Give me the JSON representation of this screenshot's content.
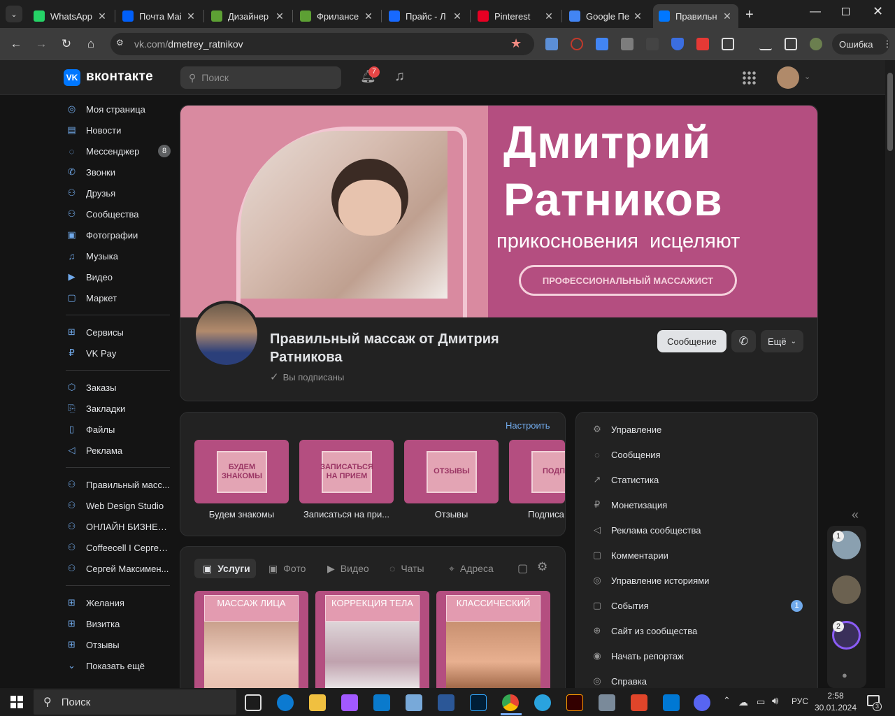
{
  "browser": {
    "tabs": [
      {
        "title": "WhatsApp",
        "icon": "whatsapp-icon",
        "color": "#25d366"
      },
      {
        "title": "Почта Mai",
        "icon": "mail-icon",
        "color": "#005ff9"
      },
      {
        "title": "Дизайнер",
        "icon": "fl-icon",
        "color": "#5da034"
      },
      {
        "title": "Фрилансе",
        "icon": "fl-icon",
        "color": "#5da034"
      },
      {
        "title": "Прайс - Л",
        "icon": "behance-icon",
        "color": "#1769ff"
      },
      {
        "title": "Pinterest",
        "icon": "pinterest-icon",
        "color": "#e60023"
      },
      {
        "title": "Google Пе",
        "icon": "translate-icon",
        "color": "#4285f4"
      },
      {
        "title": "Правильн",
        "icon": "vk-icon",
        "color": "#0077ff"
      }
    ],
    "url_host": "vk.com/",
    "url_path": "dmetrey_ratnikov",
    "profile_status": "Ошибка"
  },
  "vk": {
    "logo_text": "вконтакте",
    "search_placeholder": "Поиск",
    "notifications_count": "7",
    "sidebar": {
      "main": [
        {
          "label": "Моя страница",
          "icon": "user-circle-icon"
        },
        {
          "label": "Новости",
          "icon": "news-icon"
        },
        {
          "label": "Мессенджер",
          "icon": "message-icon",
          "badge": "8"
        },
        {
          "label": "Звонки",
          "icon": "phone-icon"
        },
        {
          "label": "Друзья",
          "icon": "friends-icon"
        },
        {
          "label": "Сообщества",
          "icon": "communities-icon"
        },
        {
          "label": "Фотографии",
          "icon": "photo-icon"
        },
        {
          "label": "Музыка",
          "icon": "music-icon"
        },
        {
          "label": "Видео",
          "icon": "video-icon"
        },
        {
          "label": "Маркет",
          "icon": "market-icon"
        }
      ],
      "services": [
        {
          "label": "Сервисы",
          "icon": "services-icon"
        },
        {
          "label": "VK Pay",
          "icon": "vkpay-icon"
        }
      ],
      "extra": [
        {
          "label": "Заказы",
          "icon": "box-icon"
        },
        {
          "label": "Закладки",
          "icon": "bookmark-icon"
        },
        {
          "label": "Файлы",
          "icon": "file-icon"
        },
        {
          "label": "Реклама",
          "icon": "megaphone-icon"
        }
      ],
      "groups": [
        {
          "label": "Правильный масс...",
          "icon": "communities-icon"
        },
        {
          "label": "Web Design Studio",
          "icon": "communities-icon"
        },
        {
          "label": "ОНЛАЙН БИЗНЕС ...",
          "icon": "communities-icon"
        },
        {
          "label": "Coffeecell I Сергей...",
          "icon": "communities-icon"
        },
        {
          "label": "Сергей Максимен...",
          "icon": "communities-icon"
        }
      ],
      "apps": [
        {
          "label": "Желания",
          "icon": "services-icon"
        },
        {
          "label": "Визитка",
          "icon": "services-icon"
        },
        {
          "label": "Отзывы",
          "icon": "services-icon"
        },
        {
          "label": "Показать ещё",
          "icon": "chevron-down-icon"
        }
      ]
    },
    "cover": {
      "name_line1": "Дмитрий",
      "name_line2": "Ратников",
      "slogan": "прикосновения  исцеляют",
      "badge": "ПРОФЕССИОНАЛЬНЫЙ МАССАЖИСТ"
    },
    "community": {
      "title": "Правильный массаж от Дмитрия Ратникова",
      "subscribed": "Вы подписаны",
      "message_btn": "Сообщение",
      "more_btn": "Ещё"
    },
    "links": {
      "configure": "Настроить",
      "items": [
        {
          "tile": "БУДЕМ ЗНАКОМЫ",
          "caption": "Будем знакомы"
        },
        {
          "tile": "ЗАПИСАТЬСЯ НА ПРИЕМ",
          "caption": "Записаться на при..."
        },
        {
          "tile": "ОТЗЫВЫ",
          "caption": "Отзывы"
        },
        {
          "tile": "ПОДПИ",
          "caption": "Подписа"
        }
      ]
    },
    "content_tabs": [
      {
        "label": "Услуги",
        "icon": "services-box-icon",
        "active": true
      },
      {
        "label": "Фото",
        "icon": "photo-icon"
      },
      {
        "label": "Видео",
        "icon": "video-icon"
      },
      {
        "label": "Чаты",
        "icon": "chats-icon"
      },
      {
        "label": "Адреса",
        "icon": "pin-icon"
      }
    ],
    "services": [
      {
        "title": "МАССАЖ ЛИЦА"
      },
      {
        "title": "КОРРЕКЦИЯ ТЕЛА"
      },
      {
        "title": "КЛАССИЧЕСКИЙ"
      }
    ],
    "manage_menu": [
      {
        "label": "Управление",
        "icon": "gear-icon"
      },
      {
        "label": "Сообщения",
        "icon": "message-icon"
      },
      {
        "label": "Статистика",
        "icon": "stats-icon"
      },
      {
        "label": "Монетизация",
        "icon": "coin-icon"
      },
      {
        "label": "Реклама сообщества",
        "icon": "megaphone-icon"
      },
      {
        "label": "Комментарии",
        "icon": "comment-icon"
      },
      {
        "label": "Управление историями",
        "icon": "stories-icon"
      },
      {
        "label": "События",
        "icon": "event-icon",
        "badge": "1"
      },
      {
        "label": "Сайт из сообщества",
        "icon": "globe-icon"
      },
      {
        "label": "Начать репортаж",
        "icon": "live-icon"
      },
      {
        "label": "Справка",
        "icon": "help-icon"
      }
    ],
    "chat_dock_badges": [
      "1",
      "2"
    ]
  },
  "taskbar": {
    "search": "Поиск",
    "lang": "РУС",
    "time": "2:58",
    "date": "30.01.2024",
    "notif_count": "3"
  },
  "colors": {
    "accent": "#0077ff",
    "brand_pink": "#b44e80",
    "link": "#71aaeb"
  }
}
